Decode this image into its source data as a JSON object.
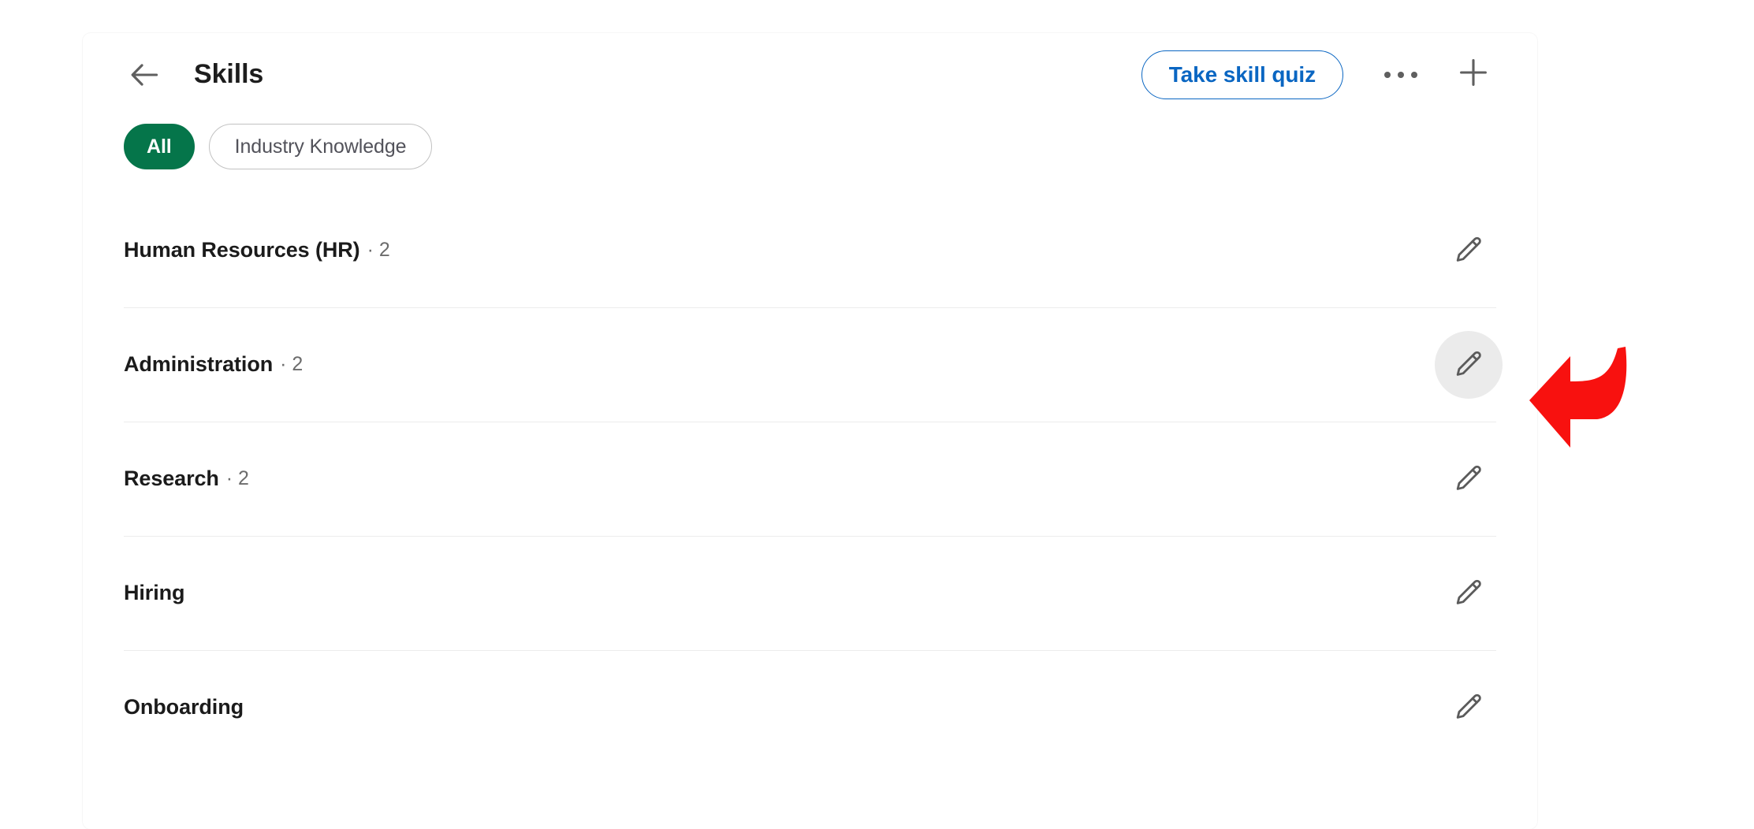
{
  "header": {
    "back_icon": "arrow-left-icon",
    "title": "Skills",
    "quiz_button_label": "Take skill quiz",
    "more_icon": "more-horizontal-icon",
    "add_icon": "plus-icon",
    "accent_color": "#0a66c2"
  },
  "filters": {
    "selected_color": "#05754a",
    "items": [
      {
        "label": "All",
        "selected": true
      },
      {
        "label": "Industry Knowledge",
        "selected": false
      }
    ]
  },
  "skills": {
    "edit_icon": "pencil-icon",
    "rows": [
      {
        "name": "Human Resources (HR)",
        "count": "· 2",
        "edit_hovered": false
      },
      {
        "name": "Administration",
        "count": "· 2",
        "edit_hovered": true
      },
      {
        "name": "Research",
        "count": "· 2",
        "edit_hovered": false
      },
      {
        "name": "Hiring",
        "count": "",
        "edit_hovered": false
      },
      {
        "name": "Onboarding",
        "count": "",
        "edit_hovered": false
      }
    ]
  },
  "annotation": {
    "arrow_icon": "curved-arrow-left-icon",
    "color": "#f8110f"
  }
}
